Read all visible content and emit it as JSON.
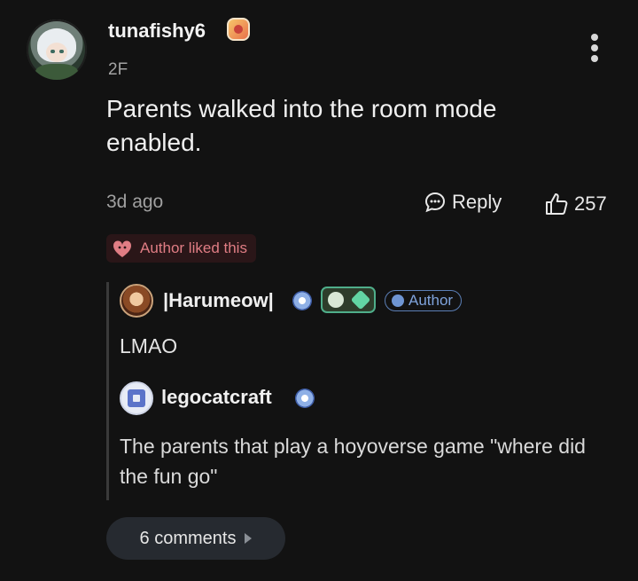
{
  "comment": {
    "username": "tunafishy6",
    "floor": "2F",
    "text": "Parents walked into the room mode enabled.",
    "time": "3d ago",
    "reply_label": "Reply",
    "like_count": "257",
    "author_liked_label": "Author liked this"
  },
  "replies": [
    {
      "username": "|Harumeow|",
      "author_tag": "Author",
      "text": "LMAO"
    },
    {
      "username": "legocatcraft",
      "text": "The parents that play a hoyoverse game \"where did the fun go\""
    }
  ],
  "more_comments_label": "6 comments",
  "colors": {
    "background": "#121212",
    "liked_accent": "#e07d84",
    "author_tag": "#7fa3dc"
  },
  "icons": [
    "avatar",
    "sticker-badge",
    "more-vertical-icon",
    "reply-bubble-icon",
    "thumbs-up-icon",
    "author-liked-icon",
    "author-badge-icon",
    "chevron-right-icon"
  ]
}
